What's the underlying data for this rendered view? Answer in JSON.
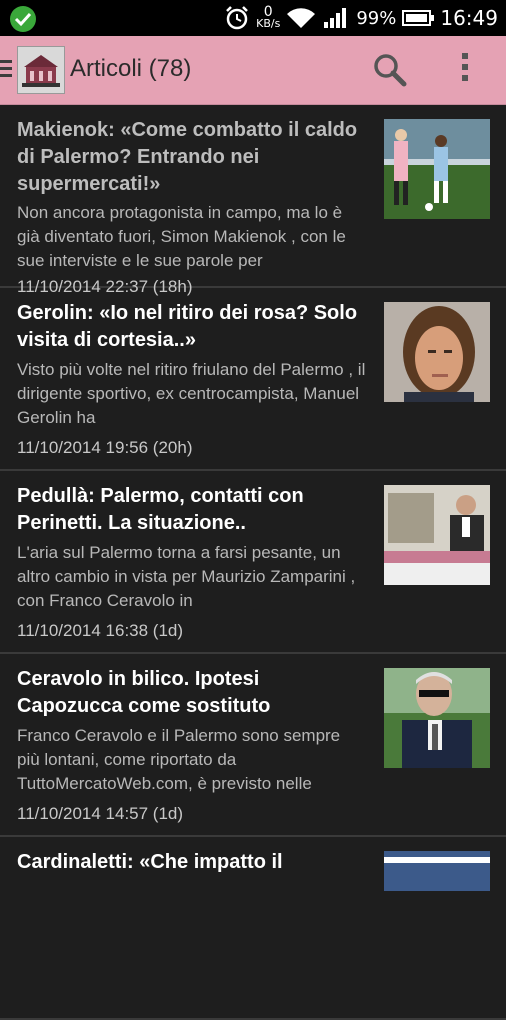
{
  "status_bar": {
    "speed_value": "0",
    "speed_unit": "KB/s",
    "battery": "99%",
    "time": "16:49"
  },
  "app_bar": {
    "title": "Articoli (78)"
  },
  "articles": [
    {
      "title": "Makienok: «Come combatto il caldo di Palermo? Entrando nei supermercati!»",
      "snippet": "Non ancora protagonista in campo, ma lo è già diventato fuori, Simon Makienok , con le sue interviste e le sue parole per",
      "date": "11/10/2014 22:37 (18h)"
    },
    {
      "title": "Gerolin: «Io nel ritiro dei rosa? Solo visita di cortesia..»",
      "snippet": "Visto più volte nel ritiro friulano del Palermo , il dirigente sportivo, ex centrocampista, Manuel Gerolin ha",
      "date": "11/10/2014 19:56 (20h)"
    },
    {
      "title": "Pedullà: Palermo, contatti con Perinetti. La situazione..",
      "snippet": "L'aria sul Palermo torna a farsi pesante, un altro cambio in vista per Maurizio Zamparini , con Franco Ceravolo in",
      "date": "11/10/2014 16:38 (1d)"
    },
    {
      "title": "Ceravolo in bilico. Ipotesi Capozucca come sostituto",
      "snippet": "Franco Ceravolo e il Palermo sono sempre più lontani, come riportato da TuttoMercatoWeb.com, è previsto nelle",
      "date": "11/10/2014 14:57 (1d)"
    },
    {
      "title": "Cardinaletti: «Che impatto il",
      "snippet": "",
      "date": ""
    }
  ]
}
